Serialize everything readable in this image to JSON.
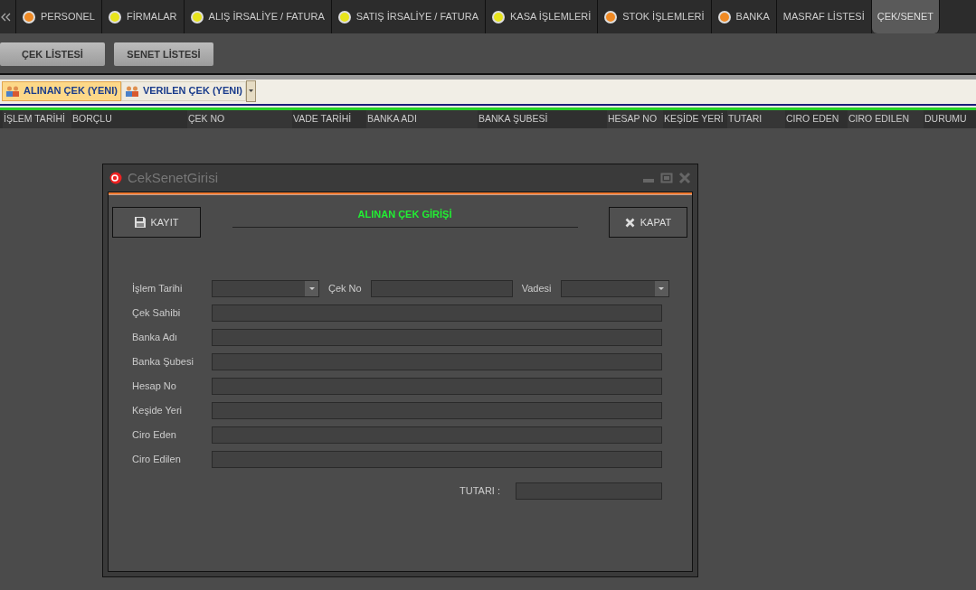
{
  "nav_tabs": [
    {
      "label": "PERSONEL",
      "color": "#f08a24",
      "selected": false
    },
    {
      "label": "FİRMALAR",
      "color": "#e8e41c",
      "selected": false
    },
    {
      "label": "ALIŞ İRSALİYE / FATURA",
      "color": "#e8e41c",
      "selected": false
    },
    {
      "label": "SATIŞ İRSALİYE / FATURA",
      "color": "#e8e41c",
      "selected": false
    },
    {
      "label": "KASA İŞLEMLERİ",
      "color": "#e8e41c",
      "selected": false
    },
    {
      "label": "STOK İŞLEMLERİ",
      "color": "#f08a24",
      "selected": false
    },
    {
      "label": "BANKA",
      "color": "#f08a24",
      "selected": false
    },
    {
      "label": "MASRAF LİSTESİ",
      "selected": false
    },
    {
      "label": "ÇEK/SENET",
      "selected": true
    }
  ],
  "list_buttons": [
    "ÇEK LİSTESİ",
    "SENET LİSTESİ"
  ],
  "tabs": [
    {
      "label": "ALINAN ÇEK (YENI)",
      "selected": true
    },
    {
      "label": "VERILEN ÇEK (YENI)",
      "selected": false
    }
  ],
  "table": {
    "columns": [
      "İŞLEM TARİHİ",
      "BORÇLU",
      "ÇEK NO",
      "VADE TARİHİ",
      "BANKA ADI",
      "BANKA ŞUBESİ",
      "HESAP NO",
      "KEŞİDE YERİ",
      "TUTARI",
      "CIRO EDEN",
      "CIRO EDILEN",
      "DURUMU"
    ]
  },
  "dialog": {
    "title": "CekSenetGirisi",
    "heading": "ALINAN ÇEK GİRİŞİ",
    "buttons": [
      {
        "label": "KAYIT",
        "kind": "save"
      },
      {
        "label": "KAPAT",
        "kind": "close"
      }
    ],
    "rows": [
      [
        {
          "label": "İşlem Tarihi",
          "kind": "combo"
        },
        {
          "label": "Çek No",
          "kind": "text"
        },
        {
          "label": "Vadesi",
          "kind": "combo"
        }
      ],
      [
        {
          "label": "Çek Sahibi",
          "kind": "text"
        }
      ],
      [
        {
          "label": "Banka Adı",
          "kind": "text"
        }
      ],
      [
        {
          "label": "Banka Şubesi",
          "kind": "text"
        }
      ],
      [
        {
          "label": "Hesap No",
          "kind": "text"
        }
      ],
      [
        {
          "label": "Keşide Yeri",
          "kind": "text"
        }
      ],
      [
        {
          "label": "Ciro Eden",
          "kind": "text"
        }
      ],
      [
        {
          "label": "Ciro Edilen",
          "kind": "text"
        }
      ]
    ],
    "total": {
      "label": "TUTARI :"
    }
  }
}
